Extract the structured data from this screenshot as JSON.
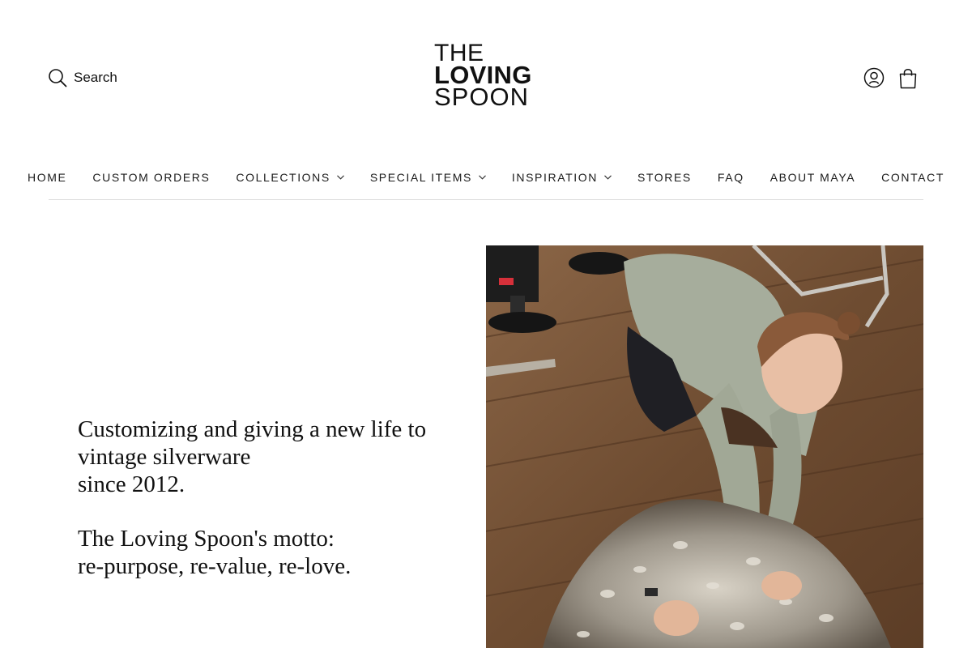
{
  "header": {
    "search_label": "Search",
    "logo": {
      "line1": "THE",
      "line2": "LOVING",
      "line3": "SPOON"
    },
    "icons": {
      "search": "search-icon",
      "account": "account-icon",
      "cart": "shopping-bag-icon"
    }
  },
  "nav": {
    "items": [
      {
        "label": "HOME",
        "dropdown": false
      },
      {
        "label": "CUSTOM ORDERS",
        "dropdown": false
      },
      {
        "label": "COLLECTIONS",
        "dropdown": true
      },
      {
        "label": "SPECIAL ITEMS",
        "dropdown": true
      },
      {
        "label": "INSPIRATION",
        "dropdown": true
      },
      {
        "label": "STORES",
        "dropdown": false
      },
      {
        "label": "FAQ",
        "dropdown": false
      },
      {
        "label": "ABOUT MAYA",
        "dropdown": false
      },
      {
        "label": "CONTACT",
        "dropdown": false
      }
    ]
  },
  "hero": {
    "line1": "Customizing and giving a new life to",
    "line2": "vintage silverware",
    "line3": "since 2012.",
    "line4": "The Loving Spoon's motto:",
    "line5": "re-purpose, re-value, re-love."
  },
  "colors": {
    "text": "#111111",
    "divider": "#dcdcdc",
    "floor": "#7a5638"
  }
}
